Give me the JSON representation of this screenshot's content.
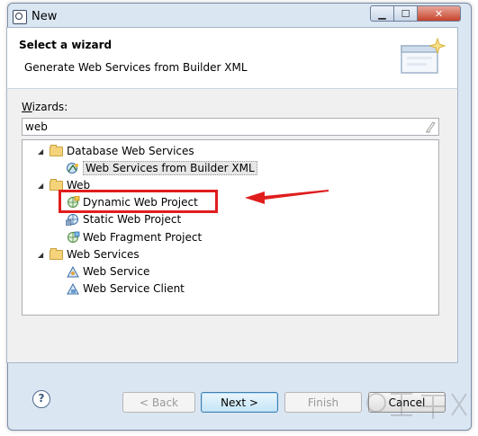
{
  "window": {
    "title": "New"
  },
  "header": {
    "title": "Select a wizard",
    "description": "Generate Web Services from Builder XML"
  },
  "wizards": {
    "label": "Wizards:",
    "filter_value": "web"
  },
  "tree": [
    {
      "label": "Database Web Services",
      "icon": "folder-icon",
      "expanded": true
    },
    {
      "label": "Web Services from Builder XML",
      "icon": "web-service-builder-icon",
      "selected": true
    },
    {
      "label": "Web",
      "icon": "folder-icon",
      "expanded": true
    },
    {
      "label": "Dynamic Web Project",
      "icon": "dynamic-web-project-icon",
      "highlighted": true
    },
    {
      "label": "Static Web Project",
      "icon": "static-web-project-icon"
    },
    {
      "label": "Web Fragment Project",
      "icon": "web-fragment-project-icon"
    },
    {
      "label": "Web Services",
      "icon": "folder-icon",
      "expanded": true
    },
    {
      "label": "Web Service",
      "icon": "web-service-icon"
    },
    {
      "label": "Web Service Client",
      "icon": "web-service-client-icon"
    }
  ],
  "buttons": {
    "back": "< Back",
    "next": "Next >",
    "finish": "Finish",
    "cancel": "Cancel"
  },
  "colors": {
    "highlight": "#e01d1d",
    "arrow": "#e01d1d"
  }
}
